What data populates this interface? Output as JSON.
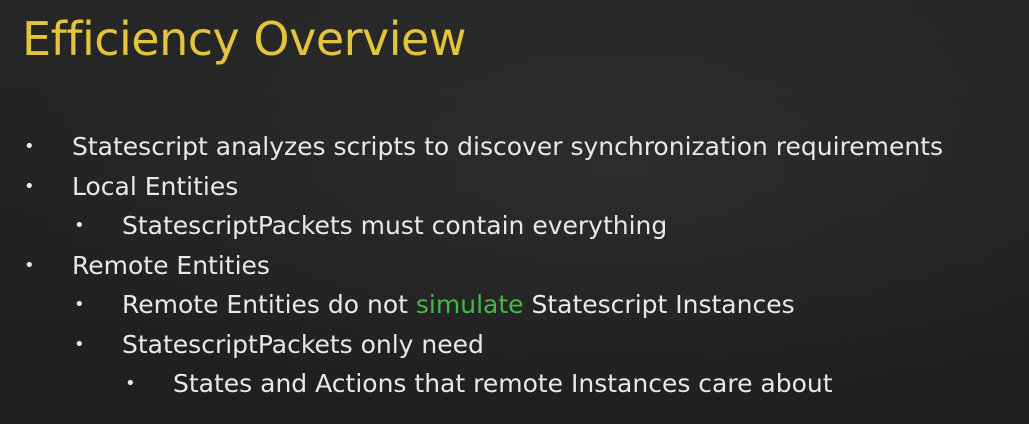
{
  "title": "Efficiency Overview",
  "bullet_glyph": "•",
  "bullets": [
    {
      "level": 0,
      "text": "Statescript analyzes scripts to discover synchronization requirements"
    },
    {
      "level": 0,
      "text": "Local Entities"
    },
    {
      "level": 1,
      "text": "StatescriptPackets must contain everything"
    },
    {
      "level": 0,
      "text": "Remote Entities"
    },
    {
      "level": 1,
      "pre": "Remote Entities do not ",
      "highlight": "simulate",
      "post": " Statescript Instances"
    },
    {
      "level": 1,
      "text": "StatescriptPackets only need"
    },
    {
      "level": 2,
      "text": "States and Actions that remote Instances care about"
    }
  ],
  "colors": {
    "title": "#e3c43d",
    "text": "#e8e8e8",
    "highlight": "#43b843",
    "background": "#222222"
  }
}
